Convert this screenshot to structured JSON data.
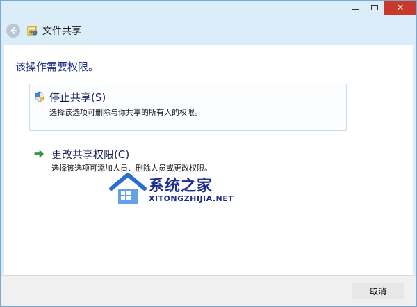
{
  "window": {
    "title": "文件共享",
    "controls": {
      "minimize_icon": "minimize-icon",
      "maximize_icon": "maximize-icon",
      "close_icon": "close-icon",
      "close_glyph": "✕"
    }
  },
  "header": {
    "back_icon": "back-arrow-icon",
    "share_icon": "file-sharing-icon",
    "title": "文件共享"
  },
  "main": {
    "instruction": "该操作需要权限。",
    "options": [
      {
        "icon": "uac-shield-icon",
        "title": "停止共享(S)",
        "description": "选择该选项可删除与你共享的所有人的权限。"
      },
      {
        "icon": "green-arrow-icon",
        "title": "更改共享权限(C)",
        "description": "选择该选项可添加人员、删除人员或更改权限。"
      }
    ]
  },
  "watermark": {
    "text": "系统之家",
    "subtext": "XITONGZHIJIA.NET"
  },
  "footer": {
    "cancel_label": "取消"
  },
  "colors": {
    "accent": "#1e3287",
    "close_button": "#c7392b",
    "frame": "#dcedfa"
  }
}
